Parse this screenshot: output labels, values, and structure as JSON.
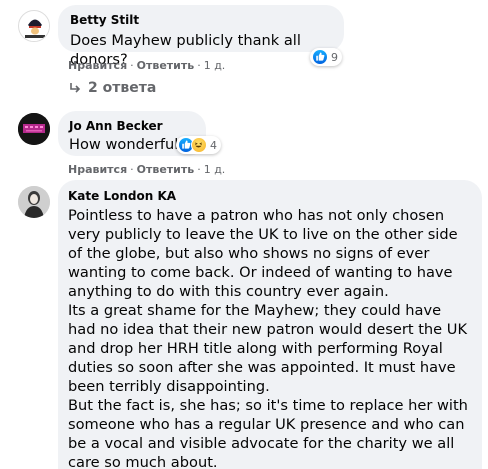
{
  "comments": [
    {
      "author": "Betty Stilt",
      "text": "Does Mayhew publicly thank all donors?",
      "reaction_count": "9",
      "reaction_icons": [
        "like-icon"
      ],
      "like_label": "Нравится",
      "reply_label": "Ответить",
      "time": "1 д."
    },
    {
      "author": "Jo Ann Becker",
      "text": "How wonderful!",
      "reaction_count": "4",
      "reaction_icons": [
        "like-icon",
        "haha-icon"
      ],
      "like_label": "Нравится",
      "reply_label": "Ответить",
      "time": "1 д."
    },
    {
      "author": "Kate London KA",
      "paragraphs": [
        "Pointless to have a patron who has not only chosen very publicly to leave the UK to live on the other side of the globe, but also who shows no signs of ever wanting to come back. Or indeed of wanting to have anything to do with this country ever again.",
        "Its a great shame for the Mayhew; they could have had no idea that their new patron would desert the UK and drop her HRH title along with performing Royal duties so soon after she was appointed. It must have been terribly disappointing.",
        "But the fact is, she has; so it's time to replace her with someone who has a regular UK presence and who can be a vocal and visible advocate for the charity we all care so much about."
      ]
    }
  ],
  "replies_toggle": "2 ответа",
  "separator": "·",
  "colors": {
    "bubble": "#f0f2f5",
    "meta_text": "#65676b",
    "like_blue": "#1877f2"
  }
}
